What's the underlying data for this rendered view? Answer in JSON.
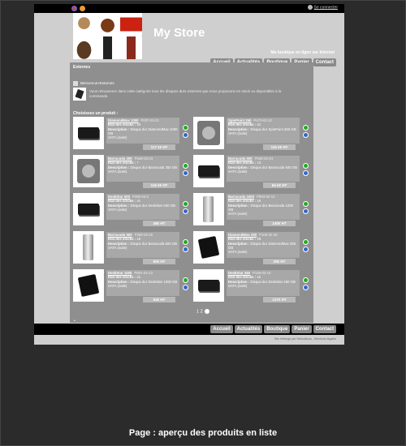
{
  "topbar": {
    "login": "Se connecter"
  },
  "header": {
    "title": "My Store",
    "tagline": "Ma boutique en ligne sur Internet"
  },
  "nav": [
    "Accueil",
    "Actualités",
    "Boutique",
    "Panier",
    "Contact"
  ],
  "category": {
    "section_title": "Externes",
    "breadcrumb": "Bienvenue>Externes",
    "description": "Vous retrouverez dans cette catégorie tous les disques durs externes que nous proposons en stock ou disponibles à la commande.",
    "choose_label": "Choisissez un produit :"
  },
  "products": [
    {
      "name": "DiamondMax 1000",
      "ref": "P007-03-21",
      "stock": "26",
      "desc": "Disque dur DiamondMax 1000 GB",
      "desc_more": "SATA (suite)",
      "price": "117 €€ HT"
    },
    {
      "name": "SpinPoint 250",
      "ref": "P470-02-22",
      "stock": "41",
      "desc": "Disque dur SpinPoint 250 GB",
      "desc_more": "SATA (suite)",
      "price": "115 €€ HT"
    },
    {
      "name": "Barracuda 250",
      "ref": "P549-03-23",
      "stock": "7",
      "desc": "Disque dur Barracuda 250 GB",
      "desc_more": "SATA (suite)",
      "price": "116 €€ HT"
    },
    {
      "name": "Barracuda 500",
      "ref": "P038-02-24",
      "stock": "13",
      "desc": "Disque dur Barracuda 500 GB",
      "desc_more": "SATA (suite)",
      "price": "64 €€ HT"
    },
    {
      "name": "DeskStar 500",
      "ref": "P496-03-2",
      "stock": "41",
      "desc": "Disque dur DeskStar 500 GB",
      "desc_more": "SATA (suite)",
      "price": "48€ HT"
    },
    {
      "name": "Barracuda 1000",
      "ref": "P903-02-12",
      "stock": "16",
      "desc": "Disque dur Barracuda 1000 GB",
      "desc_more": "SATA (suite)",
      "price": "140€ HT"
    },
    {
      "name": "Barracuda 500",
      "ref": "P368-02-25",
      "stock": "15",
      "desc": "Disque dur Barracuda 500 GB",
      "desc_more": "SATA (suite)",
      "price": "50€ HT"
    },
    {
      "name": "DiamondMax 250",
      "ref": "P105-02-26",
      "stock": "28",
      "desc": "Disque dur DiamondMax 250 GB",
      "desc_more": "SATA (suite)",
      "price": "29€ HT"
    },
    {
      "name": "DeskStar 1000",
      "ref": "P801-03-13",
      "stock": "21",
      "desc": "Disque dur DeskStar 1000 GB",
      "desc_more": "SATA (suite)",
      "price": "54€ HT"
    },
    {
      "name": "DeskStar 250",
      "ref": "P149-02-16",
      "stock": "16",
      "desc": "Disque dur DeskStar 250 GB",
      "desc_more": "SATA (suite)",
      "price": "137€ HT"
    }
  ],
  "labels": {
    "stock": "Etat des stocks :",
    "desc": "Description :"
  },
  "pager": {
    "pages": "1 2"
  },
  "footer": {
    "credits": "Site hébergé par Webcalloos - Mentions légales"
  },
  "caption": "Page : aperçu des produits en liste"
}
